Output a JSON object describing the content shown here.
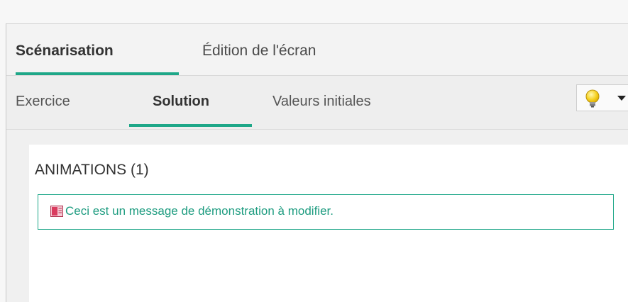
{
  "main_tabs": [
    {
      "label": "Scénarisation",
      "active": true
    },
    {
      "label": "Édition de l'écran",
      "active": false
    }
  ],
  "sub_tabs": [
    {
      "label": "Exercice",
      "active": false
    },
    {
      "label": "Solution",
      "active": true
    },
    {
      "label": "Valeurs initiales",
      "active": false
    }
  ],
  "toolbar": {
    "hint_icon": "lightbulb-icon",
    "dropdown_icon": "caret-down-icon"
  },
  "animations": {
    "section_title": "ANIMATIONS (1)",
    "items": [
      {
        "icon": "message-icon",
        "text": "Ceci est un message de démonstration à modifier."
      }
    ]
  },
  "colors": {
    "accent": "#1ea788",
    "item_text": "#1e9c80",
    "message_icon": "#d93b5e"
  }
}
